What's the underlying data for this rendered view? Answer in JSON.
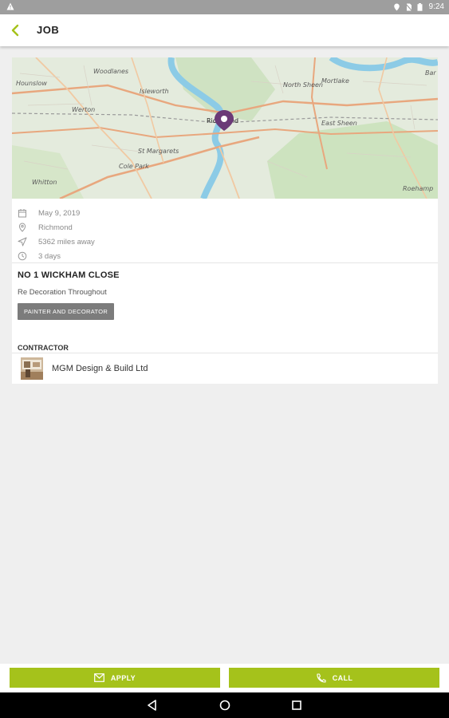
{
  "status_bar": {
    "time": "9:24"
  },
  "app_bar": {
    "title": "JOB"
  },
  "map": {
    "labels": [
      "Hounslow",
      "Woodlanes",
      "Isleworth",
      "Werton",
      "North Sheen",
      "Mortlake",
      "East Sheen",
      "Richmond",
      "St Margarets",
      "Cole Park",
      "Whitton",
      "Roehamp",
      "Bar"
    ]
  },
  "job": {
    "date": "May 9, 2019",
    "location": "Richmond",
    "distance": "5362 miles away",
    "duration": "3 days",
    "title": "NO 1 WICKHAM CLOSE",
    "description": "Re Decoration Throughout",
    "tag": "PAINTER AND DECORATOR"
  },
  "contractor": {
    "section_label": "CONTRACTOR",
    "name": "MGM Design & Build Ltd"
  },
  "actions": {
    "apply": "APPLY",
    "call": "CALL"
  },
  "colors": {
    "accent": "#a5c21b",
    "pin": "#6b3a77",
    "tag": "#7c7c7c"
  }
}
